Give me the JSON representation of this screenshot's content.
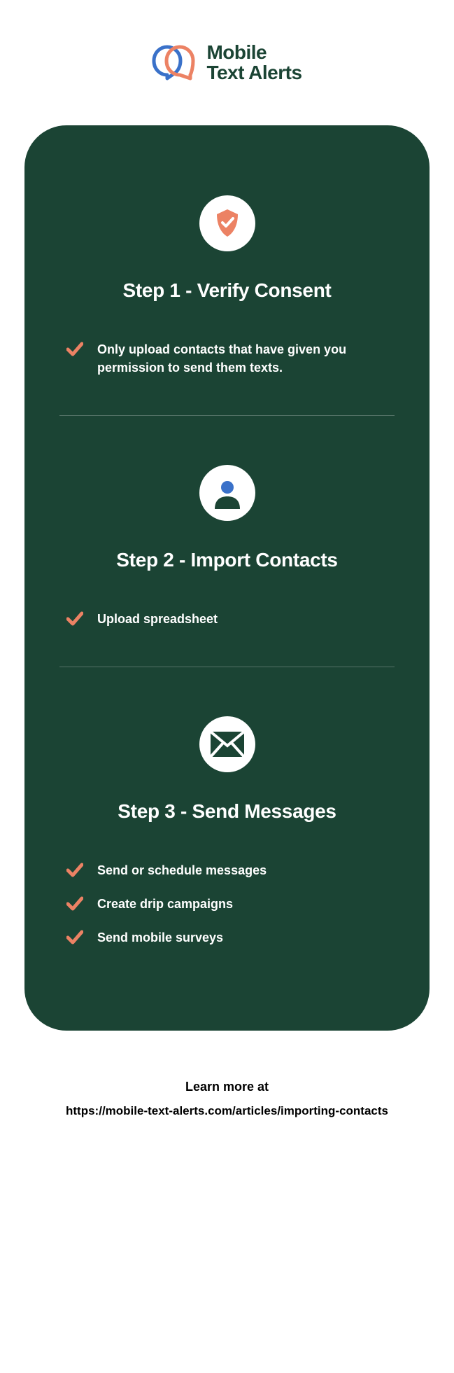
{
  "brand": {
    "line1": "Mobile",
    "line2": "Text Alerts"
  },
  "steps": [
    {
      "title": "Step 1 - Verify Consent",
      "bullets": [
        "Only upload contacts that have given you permission to send them texts."
      ]
    },
    {
      "title": "Step 2 - Import Contacts",
      "bullets": [
        "Upload spreadsheet"
      ]
    },
    {
      "title": "Step 3 - Send Messages",
      "bullets": [
        "Send or schedule messages",
        "Create drip campaigns",
        "Send mobile surveys"
      ]
    }
  ],
  "footer": {
    "line1": "Learn more at",
    "line2": "https://mobile-text-alerts.com/articles/importing-contacts"
  },
  "colors": {
    "accent": "#ec8264",
    "blue": "#3a71c9",
    "card": "#1b4434"
  }
}
